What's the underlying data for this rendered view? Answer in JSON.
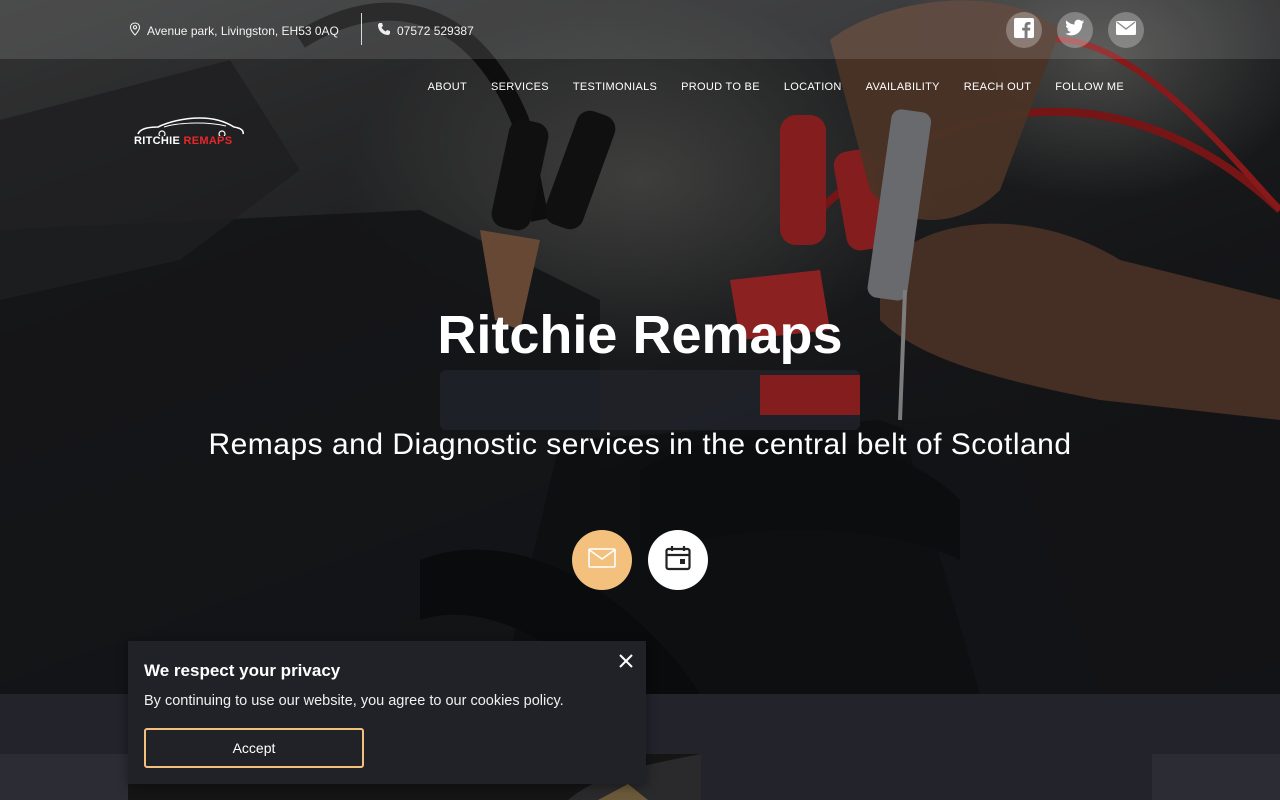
{
  "topbar": {
    "address": "Avenue park, Livingston, EH53 0AQ",
    "phone": "07572 529387",
    "social": [
      "facebook-icon",
      "twitter-icon",
      "email-icon"
    ]
  },
  "nav": {
    "items": [
      "ABOUT",
      "SERVICES",
      "TESTIMONIALS",
      "PROUD TO BE",
      "LOCATION",
      "AVAILABILITY",
      "REACH OUT",
      "FOLLOW ME"
    ]
  },
  "logo": {
    "word1": "RITCHIE",
    "word2": "REMAPS"
  },
  "hero": {
    "title": "Ritchie Remaps",
    "subtitle": "Remaps and Diagnostic services in the central belt of Scotland"
  },
  "cookie": {
    "title": "We respect your privacy",
    "text": "By continuing to use our website, you agree to our cookies policy.",
    "accept_label": "Accept"
  },
  "colors": {
    "accent": "#f3c07e",
    "logo_red": "#e8272b",
    "dark": "#22232b"
  }
}
